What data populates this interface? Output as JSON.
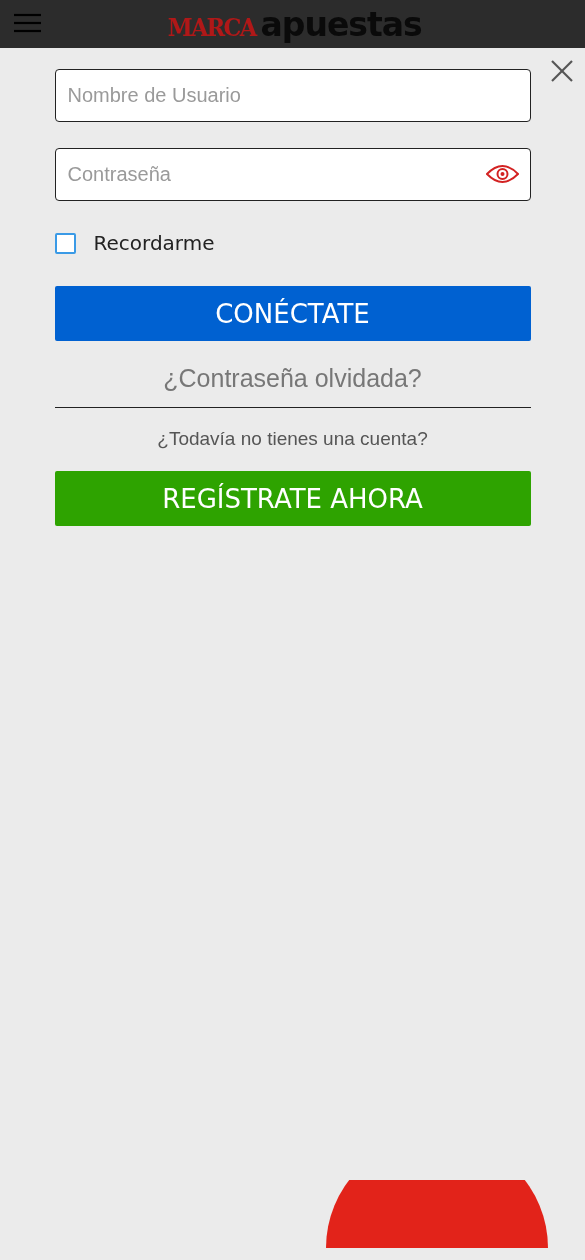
{
  "header": {
    "logo": {
      "brand": "MARCA",
      "product": "apuestas"
    }
  },
  "login": {
    "username": {
      "placeholder": "Nombre de Usuario"
    },
    "password": {
      "placeholder": "Contraseña"
    },
    "remember": {
      "label": "Recordarme",
      "checked": false
    },
    "login_button": "CONÉCTATE",
    "forgot_link": "¿Contraseña olvidada?",
    "no_account_text": "¿Todavía no tienes una cuenta?",
    "register_button": "REGÍSTRATE AHORA"
  }
}
